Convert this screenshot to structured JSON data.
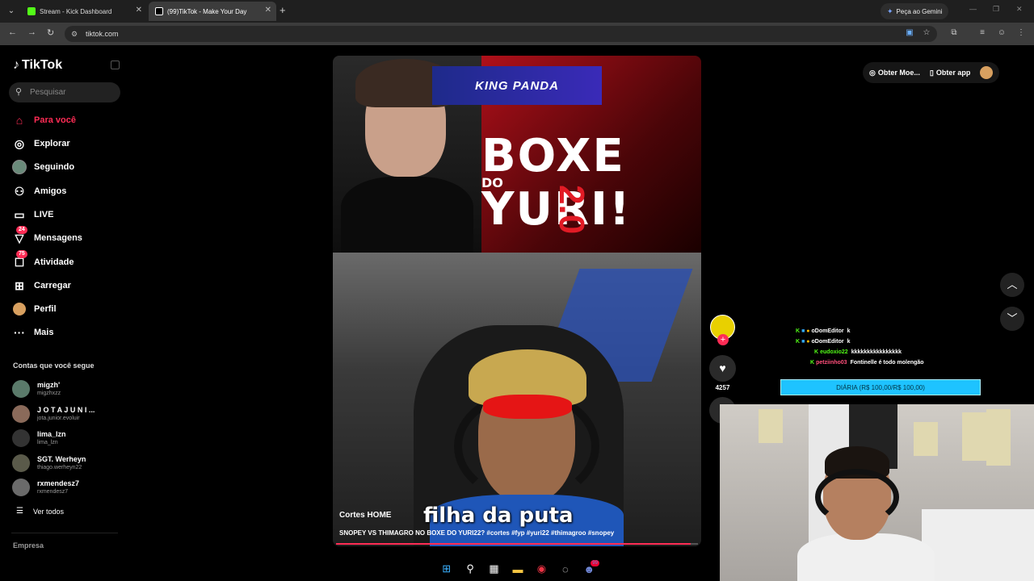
{
  "browser": {
    "tabs": [
      {
        "title": "Stream - Kick Dashboard",
        "favicon": "kick-icon",
        "color": "#53fc18"
      },
      {
        "title": "(99)TikTok - Make Your Day",
        "favicon": "tiktok-icon",
        "color": "#ffffff"
      }
    ],
    "gemini_label": "Peça ao Gemini",
    "url": "tiktok.com"
  },
  "sidebar": {
    "logo": "TikTok",
    "search_placeholder": "Pesquisar",
    "nav": [
      {
        "label": "Para você",
        "icon": "home-icon",
        "active": true
      },
      {
        "label": "Explorar",
        "icon": "compass-icon"
      },
      {
        "label": "Seguindo",
        "icon": "following-avatar-icon"
      },
      {
        "label": "Amigos",
        "icon": "friends-icon"
      },
      {
        "label": "LIVE",
        "icon": "live-icon"
      },
      {
        "label": "Mensagens",
        "icon": "messages-icon",
        "badge": "24"
      },
      {
        "label": "Atividade",
        "icon": "activity-icon",
        "badge": "75"
      },
      {
        "label": "Carregar",
        "icon": "upload-icon"
      },
      {
        "label": "Perfil",
        "icon": "profile-icon"
      },
      {
        "label": "Mais",
        "icon": "more-icon"
      }
    ],
    "following_title": "Contas que você segue",
    "accounts": [
      {
        "name": "migzh'",
        "handle": "migzhxzz"
      },
      {
        "name": "J O T A  J U N I ...",
        "handle": "jota.junior.evoluir"
      },
      {
        "name": "lima_lzn",
        "handle": "lima_lzn"
      },
      {
        "name": "SGT. Werheyn",
        "handle": "thiago.werheyn22"
      },
      {
        "name": "rxmendesz7",
        "handle": "rxmendesz7"
      }
    ],
    "see_all": "Ver todos",
    "company": "Empresa"
  },
  "video": {
    "banner_brand": "KING PANDA",
    "title_art": "BOXE",
    "title_art_do": "DO",
    "title_art_yuri": "YURI!",
    "title_art_num": "2.0",
    "caption": "filha da puta",
    "author": "Cortes HOME",
    "description": "SNOPEY VS THIMAGRO NO BOXE DO YURI22? #cortes #fyp #yuri22 #thimagroo #snopey",
    "progress": 0.98
  },
  "actions": {
    "likes": "4257"
  },
  "topbar": {
    "coins": "Obter Moe...",
    "app": "Obter app"
  },
  "chat": {
    "lines": [
      {
        "user": "oDomEditor",
        "msg": "k",
        "color": "#ffffff"
      },
      {
        "user": "oDomEditor",
        "msg": "k",
        "color": "#ffffff"
      },
      {
        "user": "eudoxio22",
        "msg": "kkkkkkkkkkkkkkkk",
        "color": "#53fc18"
      },
      {
        "user": "petziinho03",
        "msg": "Fontinelle é todo molengão",
        "color": "#ff4f7b"
      }
    ],
    "goal": "DIÁRIA (R$ 100,00/R$ 100,00)"
  }
}
